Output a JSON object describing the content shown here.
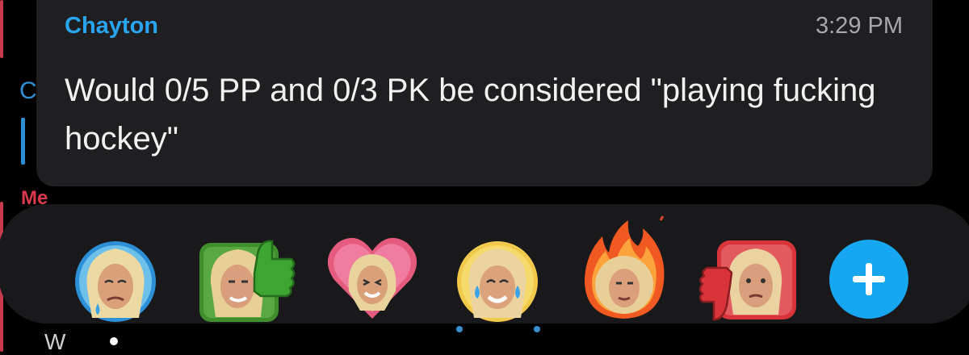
{
  "message": {
    "sender": "Chayton",
    "time": "3:29 PM",
    "text": "Would 0/5 PP and 0/3 PK be considered \"playing fucking hockey\""
  },
  "background": {
    "partial_letter": "C",
    "me_label": "Me",
    "partial_text": "W"
  },
  "reactions": [
    {
      "icon": "crying-face-icon",
      "accent": "#2d8fd5"
    },
    {
      "icon": "thumbs-up-icon",
      "accent": "#3f8f2c"
    },
    {
      "icon": "heart-icon",
      "accent": "#e55b7d"
    },
    {
      "icon": "laughing-tears-icon",
      "accent": "#f1c94a"
    },
    {
      "icon": "fire-icon",
      "accent": "#f05a22"
    },
    {
      "icon": "thumbs-down-icon",
      "accent": "#d9343a"
    }
  ],
  "add_reaction": {
    "icon": "plus-icon",
    "color": "#17a6f0"
  }
}
